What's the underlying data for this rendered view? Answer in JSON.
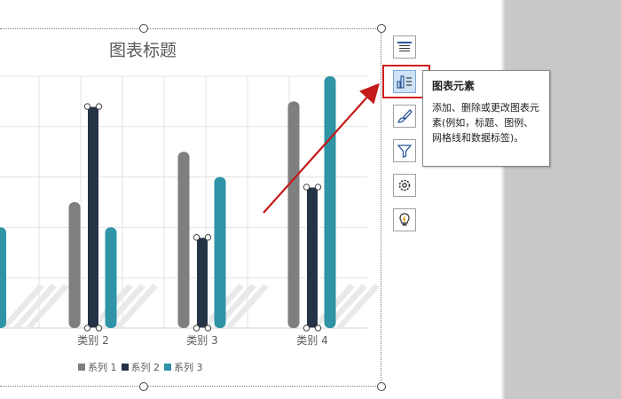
{
  "chart_data": {
    "type": "bar",
    "title": "图表标题",
    "categories": [
      "类别 2",
      "类别 3",
      "类别 4"
    ],
    "series": [
      {
        "name": "系列 1",
        "color": "#7f7f7f",
        "values": [
          2.5,
          3.5,
          4.5
        ]
      },
      {
        "name": "系列 2",
        "color": "#253347",
        "values": [
          4.4,
          1.8,
          2.8
        ]
      },
      {
        "name": "系列 3",
        "color": "#2e94a6",
        "values": [
          2.0,
          3.0,
          5.0
        ]
      }
    ],
    "ylim": [
      0,
      5
    ],
    "grid": true,
    "legend": "bottom",
    "left_partial_series3_value": 2.0
  },
  "side_buttons": [
    {
      "name": "chart-layout-button",
      "icon": "layout-icon"
    },
    {
      "name": "chart-elements-button",
      "icon": "chart-elements-icon"
    },
    {
      "name": "chart-styles-button",
      "icon": "paintbrush-icon"
    },
    {
      "name": "chart-filters-button",
      "icon": "filter-icon"
    },
    {
      "name": "chart-settings-button",
      "icon": "gear-icon"
    },
    {
      "name": "chart-ideas-button",
      "icon": "lightbulb-icon"
    }
  ],
  "tooltip": {
    "title": "图表元素",
    "description": "添加、删除或更改图表元素(例如，标题、图例、网格线和数据标签)。"
  },
  "colors": {
    "annotation_red": "#d01c1c"
  }
}
